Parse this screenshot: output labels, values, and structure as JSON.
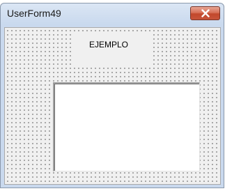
{
  "window": {
    "title": "UserForm49",
    "close_icon": "close-icon"
  },
  "form": {
    "label_text": "EJEMPLO",
    "textbox_value": ""
  },
  "colors": {
    "titlebar": "#c9d9ee",
    "close_button": "#c7543b",
    "form_background": "#f0f0f0",
    "grid_dots": "#4a4a4a",
    "textbox_background": "#ffffff"
  }
}
